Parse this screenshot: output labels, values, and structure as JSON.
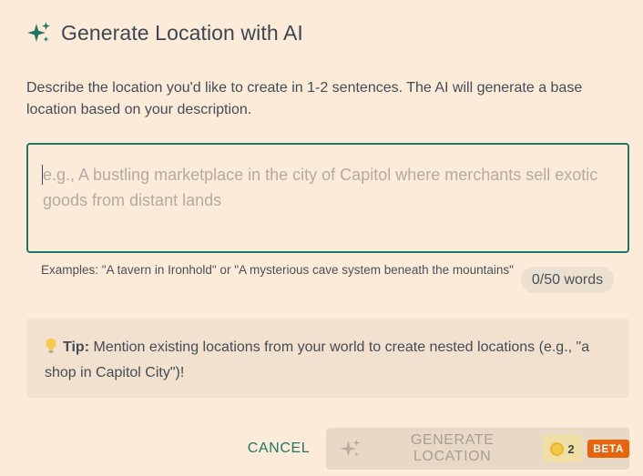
{
  "dialog": {
    "title": "Generate Location with AI",
    "icon": "sparkles-icon",
    "description": "Describe the location you'd like to create in 1-2 sentences. The AI will generate a base location based on your description."
  },
  "input": {
    "value": "",
    "placeholder": "e.g., A bustling marketplace in the city of Capitol where merchants sell exotic goods from distant lands"
  },
  "helper": {
    "examples": "Examples: \"A tavern in Ironhold\" or \"A mysterious cave system beneath the mountains\"",
    "word_count": "0/50 words"
  },
  "tip": {
    "icon": "lightbulb-icon",
    "label": "Tip:",
    "text": "Mention existing locations from your world to create nested locations (e.g., \"a shop in Capitol City\")!"
  },
  "footer": {
    "cancel_label": "CANCEL",
    "generate_label": "GENERATE LOCATION",
    "credit_cost": "2",
    "beta_label": "BETA"
  },
  "colors": {
    "background": "#fcebd8",
    "accent": "#1f7866",
    "beta": "#e8640c",
    "coin": "#f2c84a"
  }
}
